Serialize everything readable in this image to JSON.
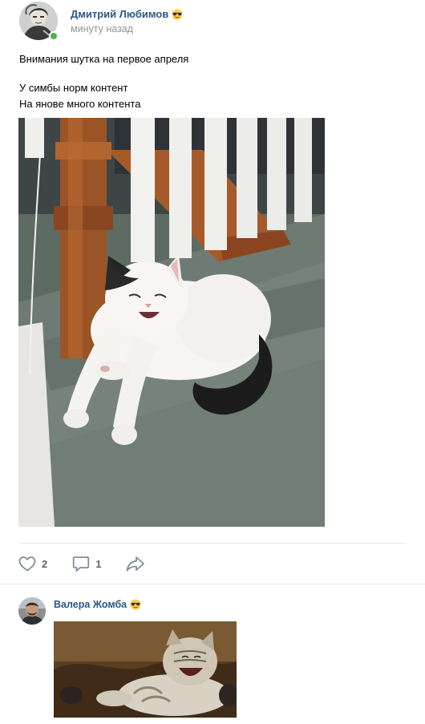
{
  "post": {
    "author_name": "Дмитрий Любимов",
    "author_emoji": "sunglasses-emoji",
    "online": true,
    "time": "минуту назад",
    "text_lines": [
      "Внимания шутка на первое апреля",
      "",
      "У симбы норм контент",
      "На янове много контента"
    ],
    "photo_subject": "laughing white-and-black cat on carpeted stairs"
  },
  "actions": {
    "likes_count": "2",
    "comments_count": "1",
    "like_icon": "heart-icon",
    "comment_icon": "comment-bubble-icon",
    "share_icon": "share-arrow-icon"
  },
  "comment": {
    "author_name": "Валера Жомба",
    "author_emoji": "sunglasses-emoji",
    "photo_subject": "laughing tabby cat lying on its back"
  },
  "colors": {
    "link_blue": "#2a5885",
    "muted_gray": "#939393",
    "online_green": "#4bb34b",
    "icon_gray": "#818c99",
    "divider": "#e7e8ec"
  }
}
